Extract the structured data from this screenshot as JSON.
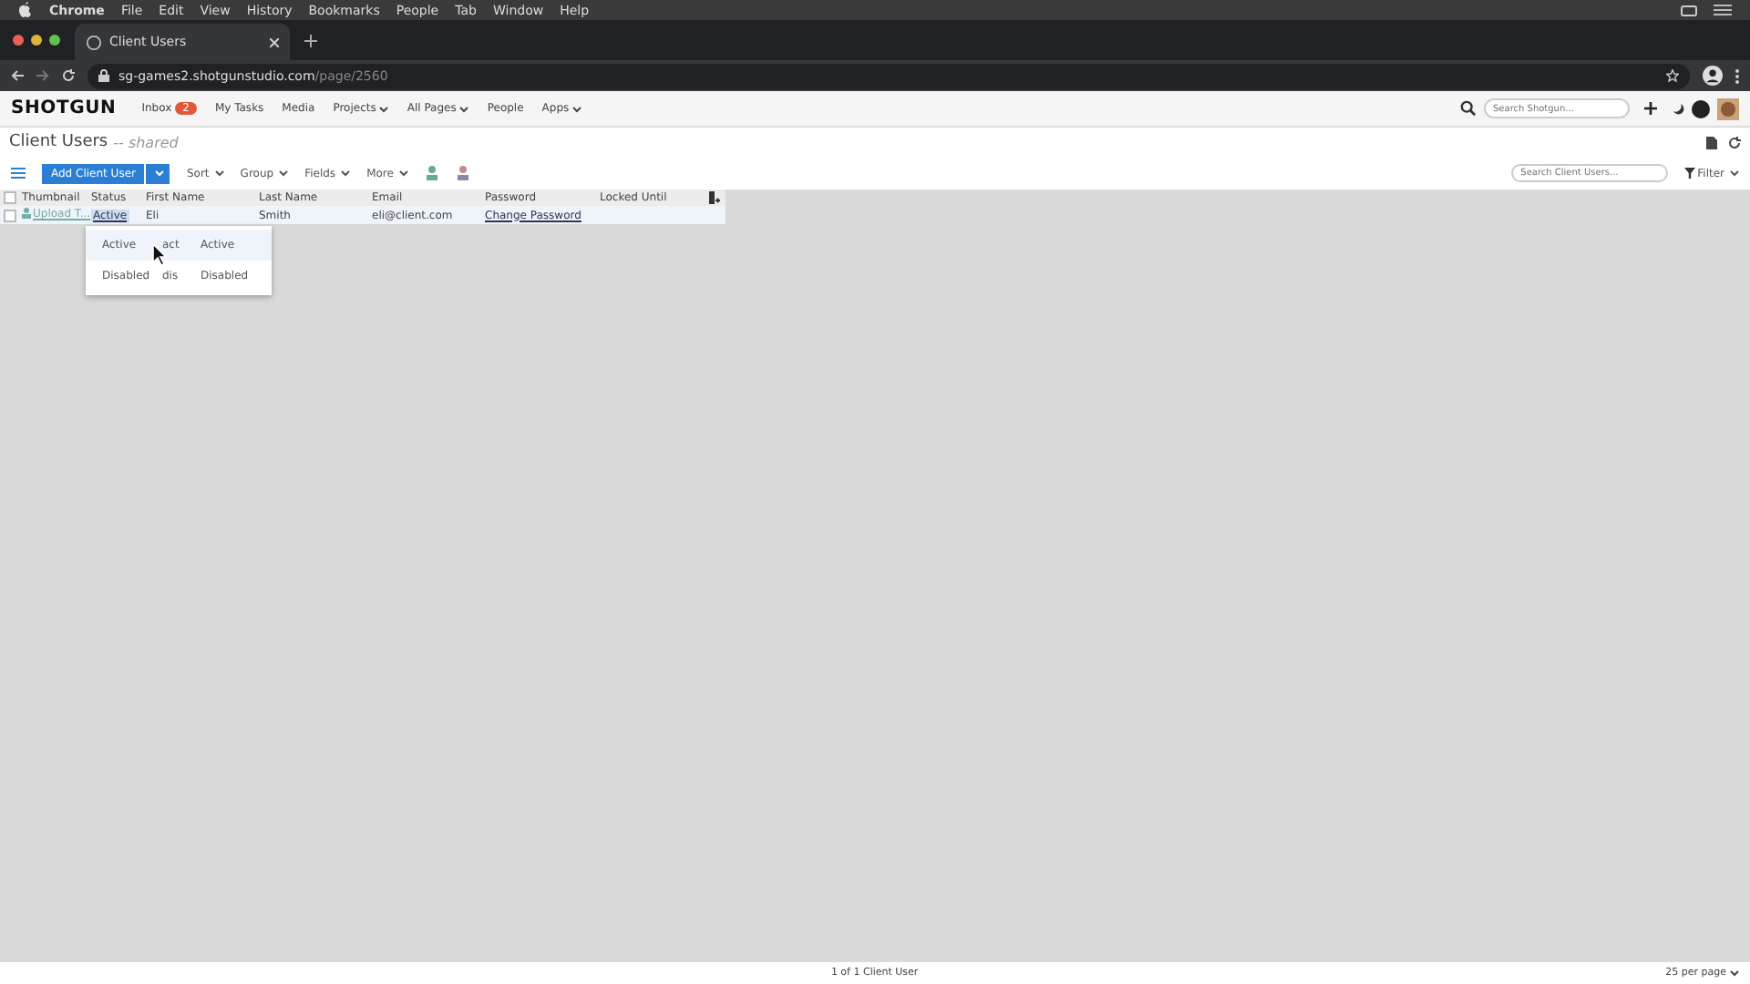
{
  "mac_menu": [
    "Chrome",
    "File",
    "Edit",
    "View",
    "History",
    "Bookmarks",
    "People",
    "Tab",
    "Window",
    "Help"
  ],
  "browser": {
    "tab_title": "Client Users",
    "url_host": "sg-games2.shotgunstudio.com",
    "url_path": "/page/2560"
  },
  "nav": {
    "logo": "SHOTGUN",
    "items": [
      {
        "label": "Inbox",
        "badge": "2",
        "dropdown": false
      },
      {
        "label": "My Tasks",
        "dropdown": false
      },
      {
        "label": "Media",
        "dropdown": false
      },
      {
        "label": "Projects",
        "dropdown": true
      },
      {
        "label": "All Pages",
        "dropdown": true
      },
      {
        "label": "People",
        "dropdown": false
      },
      {
        "label": "Apps",
        "dropdown": true
      }
    ],
    "search_placeholder": "Search Shotgun..."
  },
  "page": {
    "title": "Client Users",
    "subtitle": "-- shared"
  },
  "toolbar": {
    "add_button": "Add Client User",
    "menus": [
      "Sort",
      "Group",
      "Fields",
      "More"
    ],
    "search_placeholder": "Search Client Users...",
    "filter": "Filter"
  },
  "table": {
    "select_all_checked": false,
    "columns": [
      "Thumbnail",
      "Status",
      "First Name",
      "Last Name",
      "Email",
      "Password",
      "Locked Until"
    ],
    "rows": [
      {
        "checked": false,
        "thumbnail": "Upload T...",
        "status": "Active",
        "first_name": "Eli",
        "last_name": "Smith",
        "email": "eli@client.com",
        "password": "Change Password",
        "selected": true
      }
    ]
  },
  "status_menu": [
    {
      "name": "Active",
      "code": "act",
      "label": "Active",
      "selected": true
    },
    {
      "name": "Disabled",
      "code": "dis",
      "label": "Disabled",
      "selected": false
    }
  ],
  "footer": {
    "count": "1 of 1 Client User",
    "per_page": "25 per page"
  }
}
